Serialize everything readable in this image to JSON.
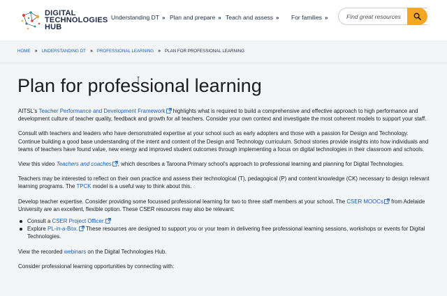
{
  "header": {
    "logo_line1": "DIGITAL",
    "logo_line2": "TECHNOLOGIES",
    "logo_line3": "HUB",
    "nav": [
      {
        "label": "Understanding DT"
      },
      {
        "label": "Plan and prepare"
      },
      {
        "label": "Teach and assess"
      },
      {
        "label": "For families"
      }
    ],
    "search_placeholder": "Find great resources",
    "accent_color": "#f5a623"
  },
  "breadcrumb": {
    "items": [
      "HOME",
      "UNDERSTANDING DT",
      "PROFESSIONAL LEARNING"
    ],
    "current": "PLAN FOR PROFESSIONAL LEARNING"
  },
  "page": {
    "title": "Plan for professional learning",
    "p1_pre": "AITSL's ",
    "p1_link": "Teacher Performance and Development Framework",
    "p1_post": " highlights what is required to build a comprehensive and effective approach to high performance and development culture of teacher quality, feedback and growth for all teachers. Consider your own context and investigate the most coherent models to support your staff.",
    "p2": "Consult with teachers and leaders who have demonstrated expertise at your school such as early adopters and those with a passion for Design and Technology. Continue building a good base understanding of the intent and content of the Design and Technology curriculum. School stories provide insights into how individuals and teams of teachers have found value, new energy and improved student outcomes through implementing a focus on digital technologies in their classroom and schools.",
    "p3_pre": "View this video ",
    "p3_link": "Teachers and coaches",
    "p3_post": ", which describes a Taroona Primary school's approach to professional learning and planning for Digital Technologies.",
    "p4_pre": "Teachers may be interested to reflect on their own practice and assess their technological (T), pedagogical (P) and content knowledge (CK) necessary to design relevant learning programs. The ",
    "p4_link": "TPCK",
    "p4_post": " model is a useful way to think about this.",
    "p5_pre": "Develop teacher expertise. Consider providing some focussed professional learning for two to three staff members at your school. The ",
    "p5_link": "CSER MOOCs",
    "p5_post": " from Adelaide University are an excellent, flexible option. These CSER resources may also be relevant:",
    "li1_pre": "Consult a ",
    "li1_link": "CSER Project Officer.",
    "li2_pre": "Explore ",
    "li2_link": "PL-in-a-Box.",
    "li2_post": " These resources are designed to support you or your team in delivering free professional learning sessions, workshops or events for Digital Technologies.",
    "p6_pre": "View the recorded ",
    "p6_link": "webinars",
    "p6_post": " on the Digital Technologies Hub.",
    "p7": "Consider professional learning opportunities by connecting with:"
  }
}
